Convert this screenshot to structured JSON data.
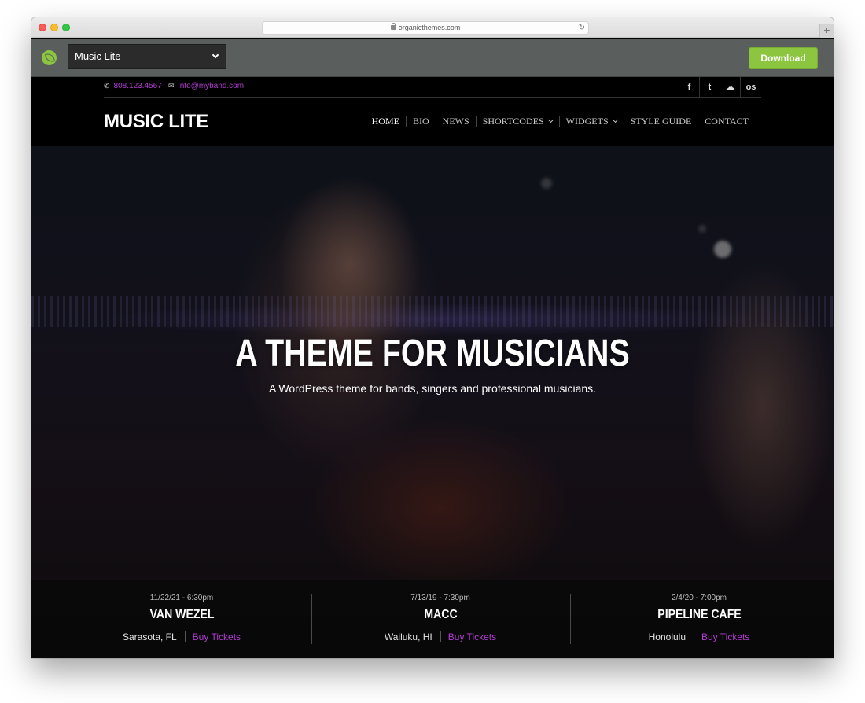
{
  "browser": {
    "url": "organicthemes.com"
  },
  "demo_bar": {
    "selected_theme": "Music Lite",
    "download_label": "Download"
  },
  "contact": {
    "phone": "808.123.4567",
    "email": "info@myband.com"
  },
  "socials": [
    {
      "icon": "facebook-icon",
      "glyph": "f"
    },
    {
      "icon": "twitter-icon",
      "glyph": "t"
    },
    {
      "icon": "soundcloud-icon",
      "glyph": "☁"
    },
    {
      "icon": "lastfm-icon",
      "glyph": "os"
    }
  ],
  "site": {
    "logo": "MUSIC LITE"
  },
  "nav": {
    "items": [
      {
        "label": "HOME",
        "active": true
      },
      {
        "label": "BIO"
      },
      {
        "label": "NEWS"
      },
      {
        "label": "SHORTCODES",
        "dropdown": true
      },
      {
        "label": "WIDGETS",
        "dropdown": true
      },
      {
        "label": "STYLE GUIDE"
      },
      {
        "label": "CONTACT"
      }
    ]
  },
  "hero": {
    "title": "A THEME FOR MUSICIANS",
    "subtitle": "A WordPress theme for bands, singers and professional musicians."
  },
  "events": [
    {
      "date": "11/22/21 - 6:30pm",
      "venue": "VAN WEZEL",
      "city": "Sarasota, FL",
      "tickets": "Buy Tickets"
    },
    {
      "date": "7/13/19 - 7:30pm",
      "venue": "MACC",
      "city": "Wailuku, HI",
      "tickets": "Buy Tickets"
    },
    {
      "date": "2/4/20 - 7:00pm",
      "venue": "PIPELINE CAFE",
      "city": "Honolulu",
      "tickets": "Buy Tickets"
    }
  ],
  "colors": {
    "accent": "#b33bd4",
    "download_green": "#8cc53f",
    "demo_bar": "#5a5f5e"
  }
}
